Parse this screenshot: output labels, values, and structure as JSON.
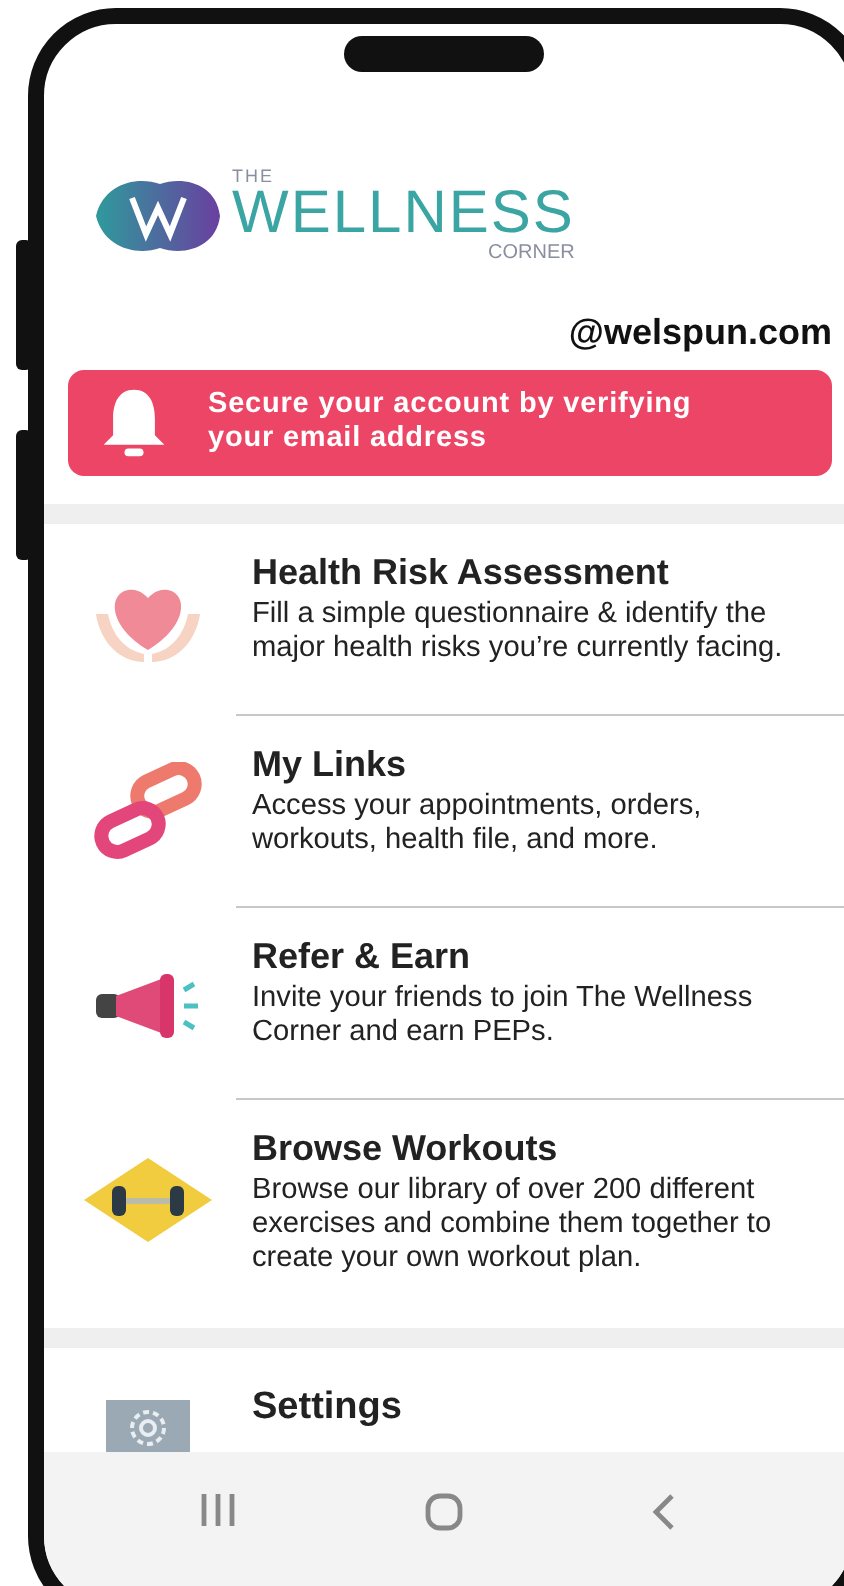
{
  "logo": {
    "top": "THE",
    "main": "WELLNESS",
    "bottom": "CORNER"
  },
  "email_domain": "@welspun.com",
  "alert": {
    "message": "Secure your account by verifying your email address"
  },
  "menu": [
    {
      "title": "Health Risk Assessment",
      "description": "Fill a simple questionnaire & identify the major health risks you’re currently facing."
    },
    {
      "title": "My Links",
      "description": "Access your appointments, orders, workouts, health file, and more."
    },
    {
      "title": "Refer & Earn",
      "description": "Invite your friends to join The Wellness Corner and earn PEPs."
    },
    {
      "title": "Browse Workouts",
      "description": "Browse our library of over  200 different exercises and combine them together to create your own workout plan."
    }
  ],
  "settings": {
    "title": "Settings"
  }
}
